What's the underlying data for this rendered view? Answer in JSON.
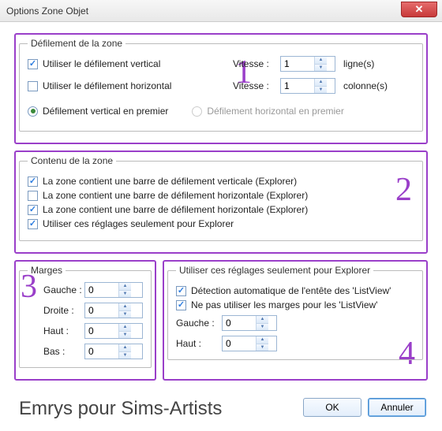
{
  "window": {
    "title": "Options Zone Objet"
  },
  "scroll": {
    "legend": "Défilement de la zone",
    "use_vertical": "Utiliser le défilement vertical",
    "use_horizontal": "Utiliser le défilement horizontal",
    "speed_label": "Vitesse :",
    "speed_v_value": "1",
    "speed_h_value": "1",
    "lines_unit": "ligne(s)",
    "cols_unit": "colonne(s)",
    "vertical_first": "Défilement vertical en premier",
    "horizontal_first": "Défilement horizontal en premier"
  },
  "content_zone": {
    "legend": "Contenu de la zone",
    "opt1": "La zone contient une barre de défilement verticale (Explorer)",
    "opt2": "La zone contient une barre de défilement horizontale (Explorer)",
    "opt3": "La zone contient une barre de défilement horizontale (Explorer)",
    "opt4": "Utiliser ces réglages seulement pour Explorer"
  },
  "margins": {
    "legend": "Marges",
    "left": "Gauche :",
    "right": "Droite :",
    "top": "Haut :",
    "bottom": "Bas :",
    "left_v": "0",
    "right_v": "0",
    "top_v": "0",
    "bottom_v": "0"
  },
  "explorer": {
    "legend": "Utiliser ces réglages seulement pour Explorer",
    "auto_header": "Détection automatique de l'entête des 'ListView'",
    "no_margins": "Ne pas utiliser les marges pour les 'ListView'",
    "left": "Gauche :",
    "top": "Haut :",
    "left_v": "0",
    "top_v": "0"
  },
  "footer": {
    "caption": "Emrys pour Sims-Artists",
    "ok": "OK",
    "cancel": "Annuler"
  },
  "annot": {
    "n1": "1",
    "n2": "2",
    "n3": "3",
    "n4": "4"
  }
}
